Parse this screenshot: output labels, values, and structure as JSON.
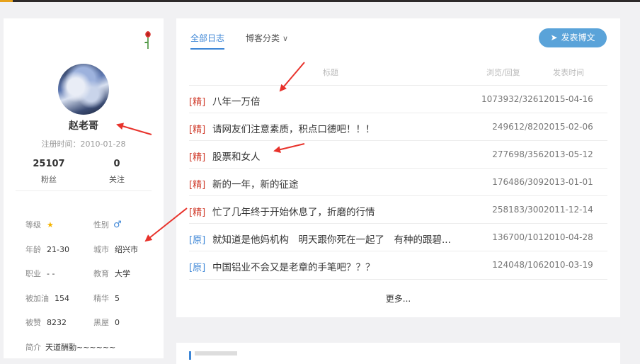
{
  "profile": {
    "nickname": "赵老哥",
    "register_time": "注册时间：2010-01-28",
    "fans_count": "25107",
    "fans_label": "粉丝",
    "follow_count": "0",
    "follow_label": "关注",
    "info": [
      {
        "key": "等级",
        "value": ""
      },
      {
        "key": "性别",
        "value": ""
      },
      {
        "key": "年龄",
        "value": "21-30"
      },
      {
        "key": "城市",
        "value": "绍兴市"
      },
      {
        "key": "职业",
        "value": "- -"
      },
      {
        "key": "教育",
        "value": "大学"
      },
      {
        "key": "被加油",
        "value": "154"
      },
      {
        "key": "精华",
        "value": "5"
      },
      {
        "key": "被赞",
        "value": "8232"
      },
      {
        "key": "黑屋",
        "value": "0"
      },
      {
        "key": "简介",
        "value": "天道酬勤~~~~~~"
      }
    ],
    "level_icon": "star-icon",
    "gender_icon": "male-icon"
  },
  "blog": {
    "tab_all": "全部日志",
    "tab_category": "博客分类",
    "post_button": "发表博文",
    "col_title": "标题",
    "col_views": "浏览/回复",
    "col_date": "发表时间",
    "more": "更多...",
    "posts": [
      {
        "tag": "[精]",
        "title": "八年一万倍",
        "views": "1073932/3261",
        "date": "2015-04-16"
      },
      {
        "tag": "[精]",
        "title": "请网友们注意素质，积点口德吧！！！",
        "views": "249612/820",
        "date": "2015-02-06"
      },
      {
        "tag": "[精]",
        "title": "股票和女人",
        "views": "277698/356",
        "date": "2013-05-12"
      },
      {
        "tag": "[精]",
        "title": "新的一年，新的征途",
        "views": "176486/309",
        "date": "2013-01-01"
      },
      {
        "tag": "[精]",
        "title": "忙了几年终于开始休息了，折磨的行情",
        "views": "258183/300",
        "date": "2011-12-14"
      },
      {
        "tag": "[原]",
        "title": "就知道是他妈机构　明天跟你死在一起了　有种的跟碧...",
        "views": "136700/101",
        "date": "2010-04-28"
      },
      {
        "tag": "[原]",
        "title": "中国铝业不会又是老章的手笔吧？？？",
        "views": "124048/106",
        "date": "2010-03-19"
      }
    ]
  },
  "colors": {
    "accent_blue": "#3d86d6",
    "jing_red": "#d03c2c",
    "arrow_red": "#e8322b"
  }
}
